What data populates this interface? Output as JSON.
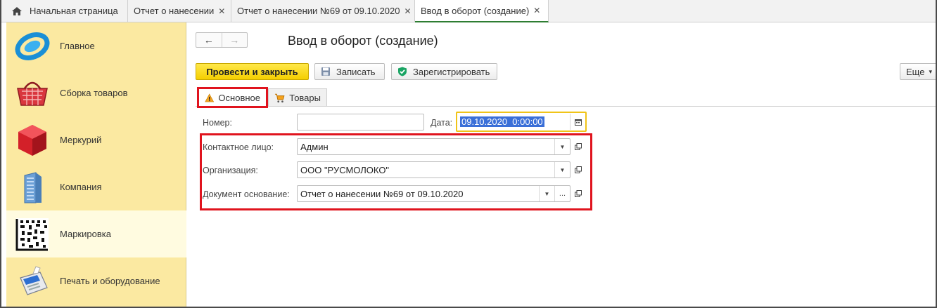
{
  "tabs": [
    {
      "label": "Начальная страница"
    },
    {
      "label": "Отчет о нанесении"
    },
    {
      "label": "Отчет о нанесении №69 от 09.10.2020"
    },
    {
      "label": "Ввод в оборот (создание)"
    }
  ],
  "sidebar": {
    "items": [
      {
        "label": "Главное"
      },
      {
        "label": "Сборка товаров"
      },
      {
        "label": "Меркурий"
      },
      {
        "label": "Компания"
      },
      {
        "label": "Маркировка"
      },
      {
        "label": "Печать и оборудование"
      }
    ]
  },
  "page": {
    "title": "Ввод в оборот (создание)"
  },
  "toolbar": {
    "post_close": "Провести и закрыть",
    "save": "Записать",
    "register": "Зарегистрировать",
    "more": "Еще"
  },
  "form_tabs": [
    {
      "label": "Основное"
    },
    {
      "label": "Товары"
    }
  ],
  "form": {
    "number_label": "Номер:",
    "number_value": "",
    "date_label": "Дата:",
    "date_value": "09.10.2020  0:00:00",
    "contact_label": "Контактное лицо:",
    "contact_value": "Админ",
    "org_label": "Организация:",
    "org_value": "ООО \"РУСМОЛОКО\"",
    "basis_label": "Документ основание:",
    "basis_value": "Отчет о нанесении №69 от 09.10.2020"
  },
  "colors": {
    "sidebar_bg": "#fbe9a1",
    "primary_button": "#f5cf00",
    "highlight_red": "#e0141e",
    "date_selection": "#3a6fd8",
    "active_tab_underline": "#2e7d32"
  }
}
